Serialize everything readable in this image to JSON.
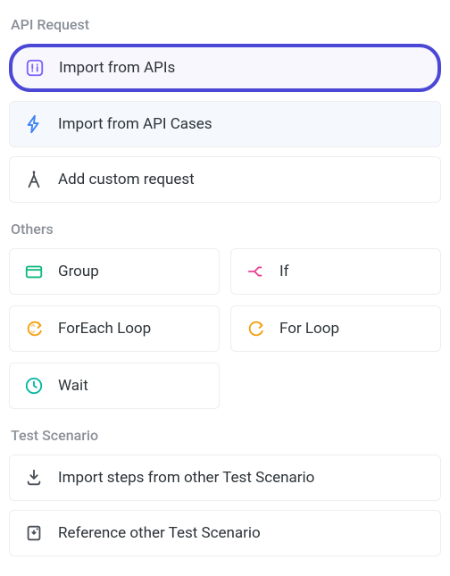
{
  "sections": {
    "api_request": {
      "header": "API Request",
      "items": [
        {
          "label": "Import from APIs"
        },
        {
          "label": "Import from API Cases"
        },
        {
          "label": "Add custom request"
        }
      ]
    },
    "others": {
      "header": "Others",
      "items": [
        {
          "label": "Group"
        },
        {
          "label": "If"
        },
        {
          "label": "ForEach Loop"
        },
        {
          "label": "For Loop"
        },
        {
          "label": "Wait"
        }
      ]
    },
    "test_scenario": {
      "header": "Test Scenario",
      "items": [
        {
          "label": "Import steps from other Test Scenario"
        },
        {
          "label": "Reference other Test Scenario"
        }
      ]
    }
  },
  "colors": {
    "highlight": "#4b48d6",
    "icon_purple": "#7b61ff",
    "icon_blue": "#3b82f6",
    "icon_gray": "#6b7280",
    "icon_green": "#10b981",
    "icon_pink": "#e84393",
    "icon_orange": "#f59e0b",
    "icon_teal": "#06b6a4"
  }
}
